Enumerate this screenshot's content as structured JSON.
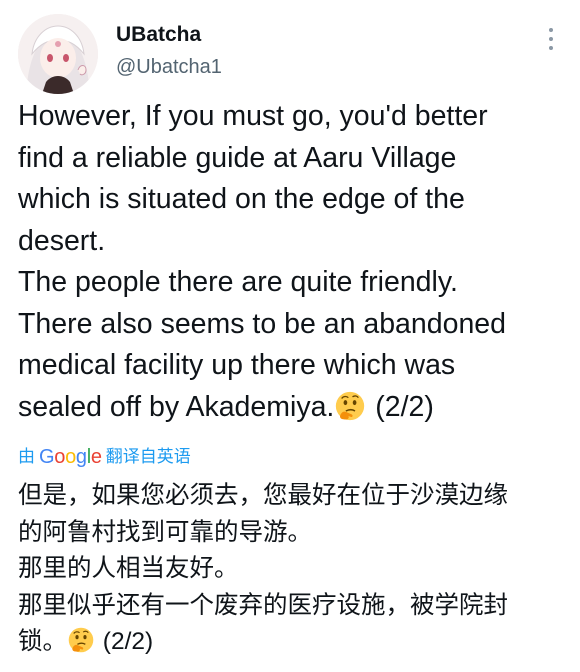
{
  "author": {
    "display_name": "UBatcha",
    "handle": "@Ubatcha1"
  },
  "tweet": {
    "lines": [
      "However, If you must go, you'd better",
      "find a reliable guide at Aaru Village",
      "which is situated on the edge of the",
      "desert.",
      "The people there are quite friendly.",
      "There also seems to be an abandoned",
      "medical facility up there which was"
    ],
    "last_line_before_emoji": "sealed off by Akademiya.",
    "last_line_after_emoji": " (2/2)",
    "emoji": "thinking-face"
  },
  "translation_bar": {
    "prefix": "由",
    "logo_letters": [
      "G",
      "o",
      "o",
      "g",
      "l",
      "e"
    ],
    "suffix": "翻译自英语"
  },
  "translation": {
    "lines": [
      "但是，如果您必须去，您最好在位于沙漠边缘",
      "的阿鲁村找到可靠的导游。",
      "那里的人相当友好。",
      "那里似乎还有一个废弃的医疗设施，被学院封"
    ],
    "last_line_before_emoji": "锁。",
    "last_line_after_emoji": " (2/2)"
  },
  "colors": {
    "text": "#0f1419",
    "secondary": "#536471",
    "link": "#1d9bf0"
  }
}
